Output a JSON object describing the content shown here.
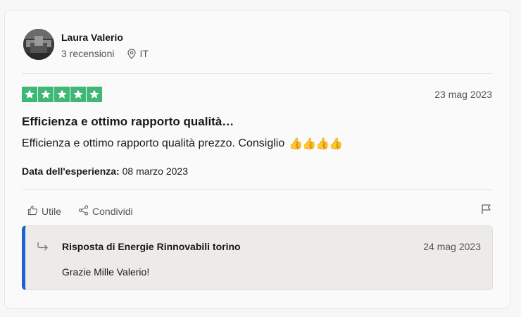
{
  "reviewer": {
    "name": "Laura Valerio",
    "reviews_count": "3 recensioni",
    "country": "IT"
  },
  "review": {
    "rating": 5,
    "max_rating": 5,
    "date": "23 mag 2023",
    "title": "Efficienza e ottimo rapporto qualità…",
    "body": "Efficienza e ottimo rapporto qualità prezzo. Consiglio",
    "body_emoji": "👍👍👍👍",
    "experience_label": "Data dell'esperienza:",
    "experience_date": "08 marzo 2023"
  },
  "actions": {
    "useful_label": "Utile",
    "share_label": "Condividi"
  },
  "reply": {
    "title": "Risposta di Energie Rinnovabili torino",
    "date": "24 mag 2023",
    "text": "Grazie Mille Valerio!"
  },
  "colors": {
    "star_green": "#3fb877",
    "reply_accent": "#1f5fd0",
    "reply_bg": "#ecebe8"
  },
  "icons": {
    "location": "location-pin-icon",
    "useful": "thumbs-up-icon",
    "share": "share-icon",
    "flag": "flag-icon",
    "reply": "reply-arrow-icon"
  }
}
